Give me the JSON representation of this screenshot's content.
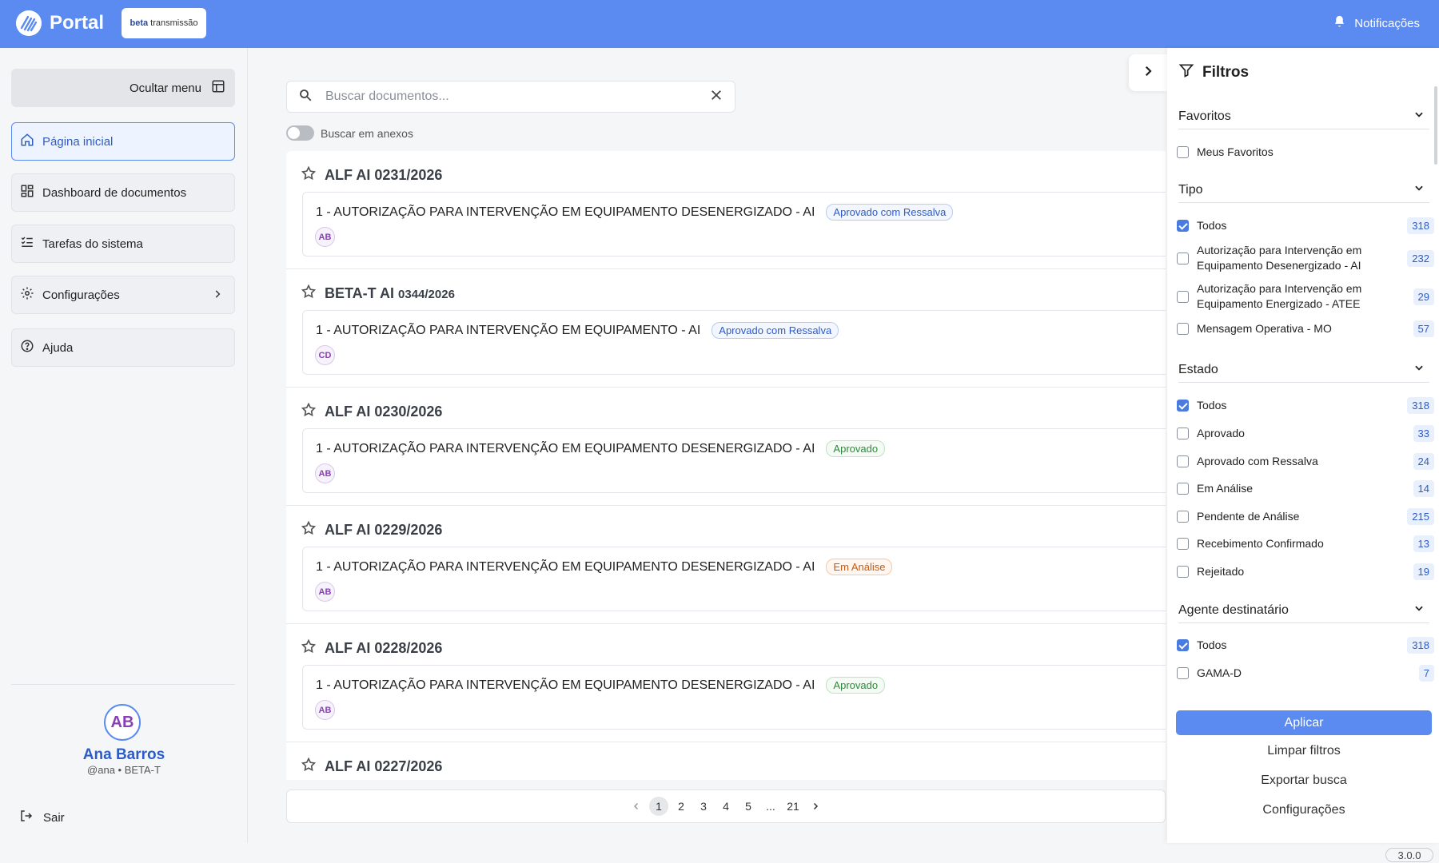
{
  "header": {
    "logo_text": "Portal",
    "env_badge_bold": "beta",
    "env_badge_text": "transmissão",
    "notifications_label": "Notificações"
  },
  "sidebar": {
    "hide_menu_label": "Ocultar menu",
    "items": [
      {
        "label": "Página inicial",
        "icon": "home-icon",
        "active": true
      },
      {
        "label": "Dashboard de documentos",
        "icon": "dashboard-icon"
      },
      {
        "label": "Tarefas do sistema",
        "icon": "tasks-icon"
      },
      {
        "label": "Configurações",
        "icon": "gear-icon"
      },
      {
        "label": "Ajuda",
        "icon": "help-icon"
      }
    ],
    "user": {
      "initials": "AB",
      "name": "Ana Barros",
      "handle": "@ana • BETA-T"
    },
    "logout_label": "Sair"
  },
  "search": {
    "placeholder": "Buscar documentos...",
    "toggle_label": "Buscar em anexos"
  },
  "documents": [
    {
      "title": "ALF AI 0231/2026",
      "line": "1 - AUTORIZAÇÃO PARA INTERVENÇÃO EM EQUIPAMENTO DESENERGIZADO - AI",
      "status": "Aprovado com Ressalva",
      "status_color": "#2d5cc8",
      "author": "AB"
    },
    {
      "title_main": "BETA-T AI",
      "title_sub": "0344/2026",
      "line": "1 - AUTORIZAÇÃO PARA INTERVENÇÃO EM EQUIPAMENTO - AI",
      "status": "Aprovado com Ressalva",
      "status_color": "#2d5cc8",
      "author": "CD"
    },
    {
      "title": "ALF AI 0230/2026",
      "line": "1 - AUTORIZAÇÃO PARA INTERVENÇÃO EM EQUIPAMENTO DESENERGIZADO - AI",
      "status": "Aprovado",
      "status_color": "#2f8a3b",
      "author": "AB"
    },
    {
      "title": "ALF AI 0229/2026",
      "line": "1 - AUTORIZAÇÃO PARA INTERVENÇÃO EM EQUIPAMENTO DESENERGIZADO - AI",
      "status": "Em Análise",
      "status_color": "#c65a16",
      "author": "AB"
    },
    {
      "title": "ALF AI 0228/2026",
      "line": "1 - AUTORIZAÇÃO PARA INTERVENÇÃO EM EQUIPAMENTO DESENERGIZADO - AI",
      "status": "Aprovado",
      "status_color": "#2f8a3b",
      "author": "AB"
    },
    {
      "title": "ALF AI 0227/2026"
    }
  ],
  "pagination": {
    "pages": [
      "1",
      "2",
      "3",
      "4",
      "5",
      "...",
      "21"
    ],
    "current": "1"
  },
  "filters": {
    "title": "Filtros",
    "sections": {
      "favoritos": {
        "label": "Favoritos",
        "items": [
          {
            "label": "Meus Favoritos",
            "checked": false
          }
        ]
      },
      "tipo": {
        "label": "Tipo",
        "items": [
          {
            "label": "Todos",
            "count": "318",
            "checked": true
          },
          {
            "label": "Autorização para Intervenção em Equipamento Desenergizado - AI",
            "count": "232",
            "checked": false
          },
          {
            "label": "Autorização para Intervenção em Equipamento Energizado - ATEE",
            "count": "29",
            "checked": false
          },
          {
            "label": "Mensagem Operativa - MO",
            "count": "57",
            "checked": false
          }
        ]
      },
      "estado": {
        "label": "Estado",
        "items": [
          {
            "label": "Todos",
            "count": "318",
            "checked": true
          },
          {
            "label": "Aprovado",
            "count": "33",
            "checked": false
          },
          {
            "label": "Aprovado com Ressalva",
            "count": "24",
            "checked": false
          },
          {
            "label": "Em Análise",
            "count": "14",
            "checked": false
          },
          {
            "label": "Pendente de Análise",
            "count": "215",
            "checked": false
          },
          {
            "label": "Recebimento Confirmado",
            "count": "13",
            "checked": false
          },
          {
            "label": "Rejeitado",
            "count": "19",
            "checked": false
          }
        ]
      },
      "agente": {
        "label": "Agente destinatário",
        "items": [
          {
            "label": "Todos",
            "count": "318",
            "checked": true
          },
          {
            "label": "GAMA-D",
            "count": "7",
            "checked": false
          }
        ]
      }
    },
    "apply_label": "Aplicar",
    "clear_label": "Limpar filtros",
    "export_label": "Exportar busca",
    "settings_label": "Configurações"
  },
  "version": "3.0.0",
  "colors": {
    "primary": "#5b8af0",
    "accent_text": "#2d5cc8",
    "avatar": "#8a3fb6"
  }
}
